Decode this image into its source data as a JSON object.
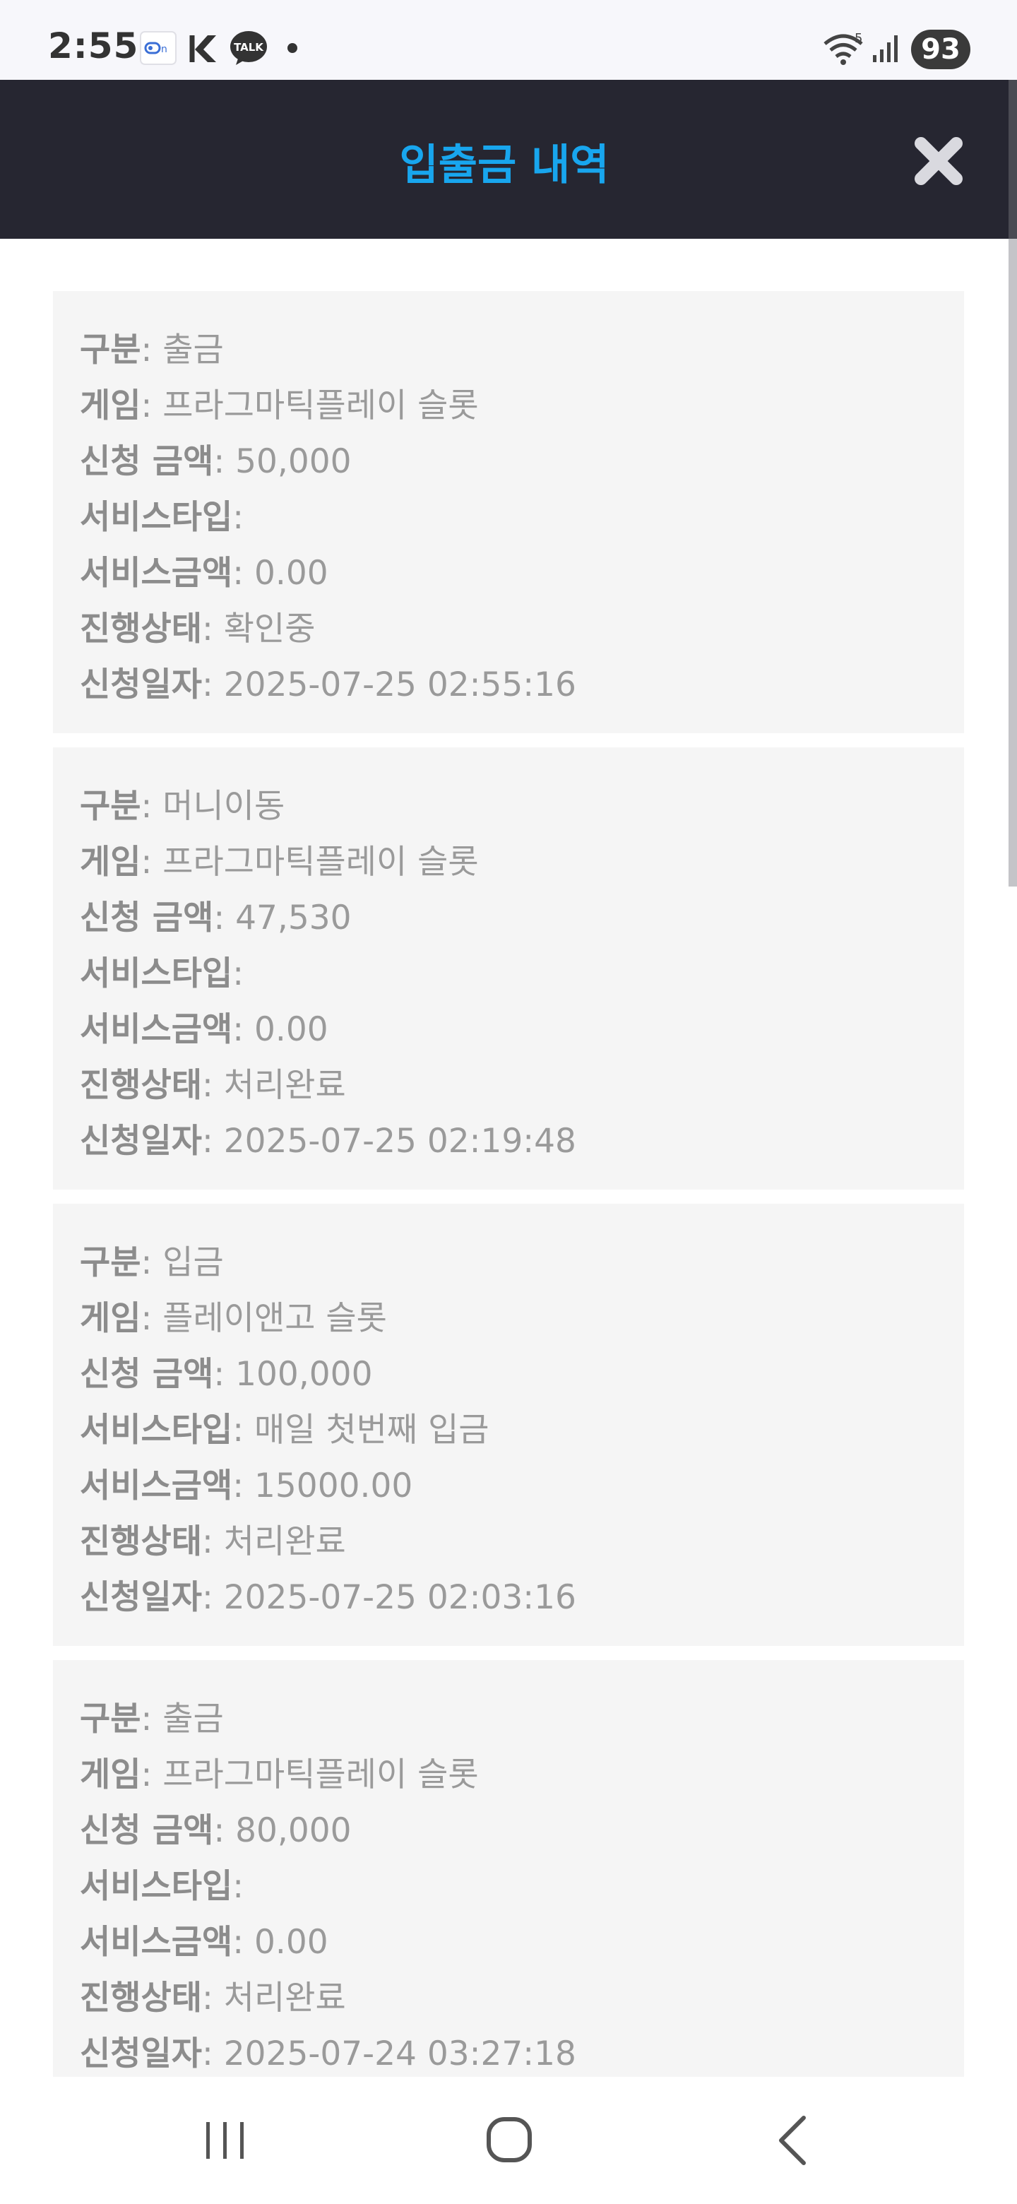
{
  "status_bar": {
    "time": "2:55",
    "battery": "93",
    "notification_icons": [
      "link-icon",
      "k-icon",
      "kakaotalk-icon",
      "dot-icon"
    ],
    "talk_label": "TALK",
    "wifi_badge": "5"
  },
  "header": {
    "title": "입출금 내역"
  },
  "records": [
    {
      "type_label": "구분",
      "type": "출금",
      "game_label": "게임",
      "game": "프라그마틱플레이 슬롯",
      "amount_label": "신청 금액",
      "amount": "50,000",
      "service_type_label": "서비스타입",
      "service_type": "",
      "service_amount_label": "서비스금액",
      "service_amount": "0.00",
      "status_label": "진행상태",
      "status": "확인중",
      "date_label": "신청일자",
      "date": "2025-07-25 02:55:16"
    },
    {
      "type_label": "구분",
      "type": "머니이동",
      "game_label": "게임",
      "game": "프라그마틱플레이 슬롯",
      "amount_label": "신청 금액",
      "amount": "47,530",
      "service_type_label": "서비스타입",
      "service_type": "",
      "service_amount_label": "서비스금액",
      "service_amount": "0.00",
      "status_label": "진행상태",
      "status": "처리완료",
      "date_label": "신청일자",
      "date": "2025-07-25 02:19:48"
    },
    {
      "type_label": "구분",
      "type": "입금",
      "game_label": "게임",
      "game": "플레이앤고 슬롯",
      "amount_label": "신청 금액",
      "amount": "100,000",
      "service_type_label": "서비스타입",
      "service_type": "매일 첫번째 입금",
      "service_amount_label": "서비스금액",
      "service_amount": "15000.00",
      "status_label": "진행상태",
      "status": "처리완료",
      "date_label": "신청일자",
      "date": "2025-07-25 02:03:16"
    },
    {
      "type_label": "구분",
      "type": "출금",
      "game_label": "게임",
      "game": "프라그마틱플레이 슬롯",
      "amount_label": "신청 금액",
      "amount": "80,000",
      "service_type_label": "서비스타입",
      "service_type": "",
      "service_amount_label": "서비스금액",
      "service_amount": "0.00",
      "status_label": "진행상태",
      "status": "처리완료",
      "date_label": "신청일자",
      "date": "2025-07-24 03:27:18"
    }
  ],
  "colors": {
    "header_bg": "#262631",
    "title": "#18a6ee",
    "card_bg": "#f5f5f5",
    "text": "#9a9a9a"
  },
  "nav_bar": [
    "recent-apps-icon",
    "home-icon",
    "back-icon"
  ]
}
